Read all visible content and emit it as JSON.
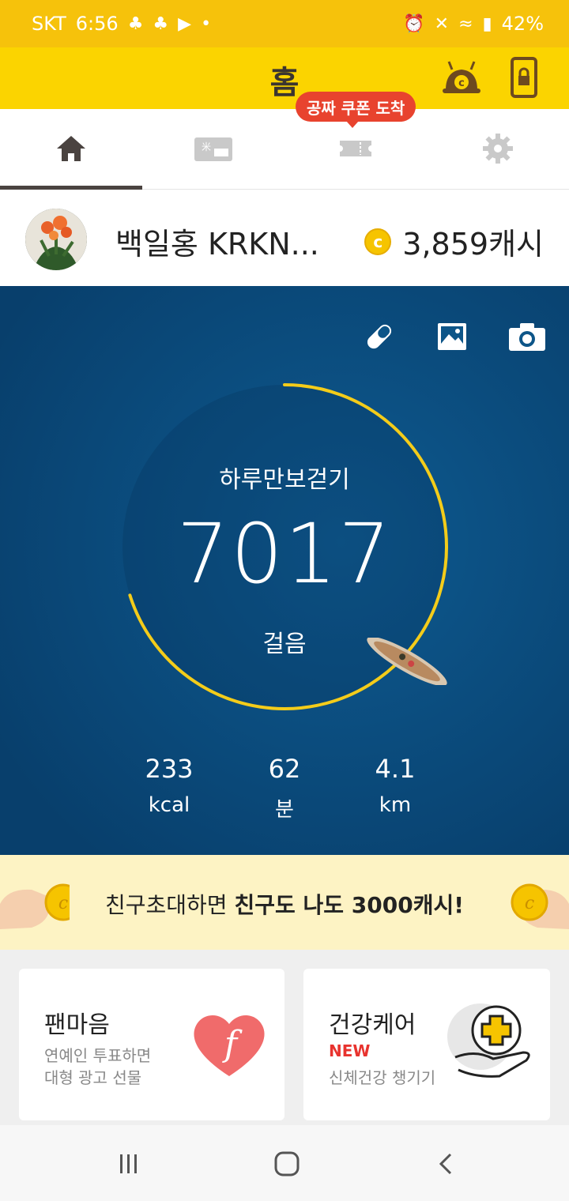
{
  "status_bar": {
    "carrier": "SKT",
    "time": "6:56",
    "battery": "42%"
  },
  "app_bar": {
    "title": "홈"
  },
  "tabs": [
    {
      "name": "home",
      "icon": "home-icon",
      "active": true
    },
    {
      "name": "gift",
      "icon": "gift-card-icon",
      "active": false
    },
    {
      "name": "coupon",
      "icon": "ticket-icon",
      "active": false
    },
    {
      "name": "settings",
      "icon": "gear-icon",
      "active": false
    }
  ],
  "coupon_tooltip": "공짜 쿠폰 도착",
  "profile": {
    "name": "백일홍 KRKN...",
    "cash": "3,859캐시",
    "cash_icon_letter": "c"
  },
  "steps": {
    "goal_label": "하루만보걷기",
    "count": "7017",
    "unit": "걸음",
    "progress": 0.7017,
    "stats": [
      {
        "value": "233",
        "unit": "kcal"
      },
      {
        "value": "62",
        "unit": "분"
      },
      {
        "value": "4.1",
        "unit": "km"
      }
    ]
  },
  "invite": {
    "text_normal": "친구초대하면 ",
    "text_bold": "친구도 나도 3000캐시!"
  },
  "cards": [
    {
      "title": "팬마음",
      "line1": "연예인 투표하면",
      "line2": "대형 광고 선물"
    },
    {
      "title": "건강케어",
      "badge": "NEW",
      "line1": "신체건강 챙기기"
    }
  ],
  "colors": {
    "brand_yellow": "#fbd400",
    "status_yellow": "#f6c20b",
    "ring": "#f4cc1a",
    "ocean": "#0d5588",
    "accent_red": "#e8432e"
  }
}
